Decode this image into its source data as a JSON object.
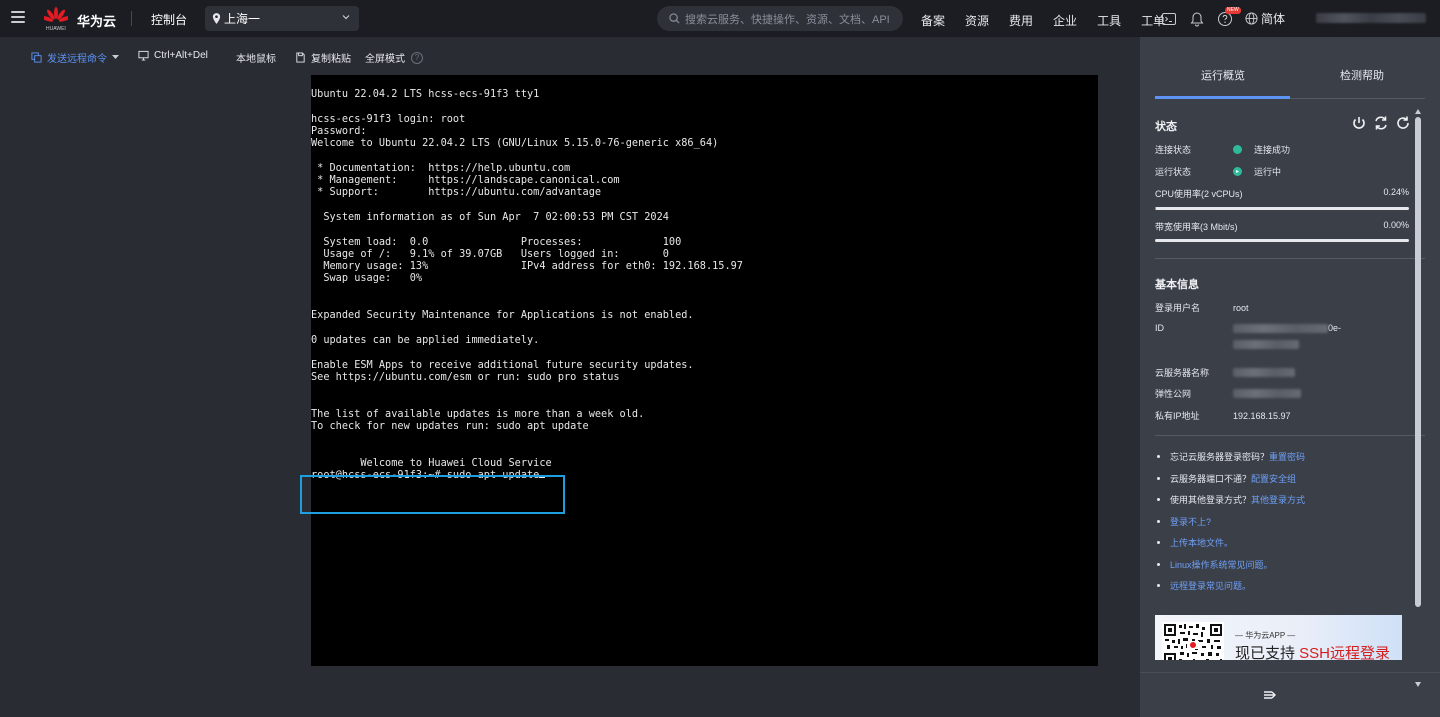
{
  "topbar": {
    "logo_text": "HUAWEI",
    "brand": "华为云",
    "console": "控制台",
    "region": "上海一",
    "search_placeholder": "搜索云服务、快捷操作、资源、文档、API",
    "nav": [
      "备案",
      "资源",
      "费用",
      "企业",
      "工具",
      "工单"
    ],
    "new_badge": "NEW",
    "language": "简体"
  },
  "toolbar": {
    "send_command": "发送远程命令",
    "ctrl_alt_del": "Ctrl+Alt+Del",
    "local_mouse": "本地鼠标",
    "copy_paste": "复制粘贴",
    "fullscreen": "全屏模式",
    "help": "?"
  },
  "terminal": {
    "lines": "Ubuntu 22.04.2 LTS hcss-ecs-91f3 tty1\n\nhcss-ecs-91f3 login: root\nPassword:\nWelcome to Ubuntu 22.04.2 LTS (GNU/Linux 5.15.0-76-generic x86_64)\n\n * Documentation:  https://help.ubuntu.com\n * Management:     https://landscape.canonical.com\n * Support:        https://ubuntu.com/advantage\n\n  System information as of Sun Apr  7 02:00:53 PM CST 2024\n\n  System load:  0.0               Processes:             100\n  Usage of /:   9.1% of 39.07GB   Users logged in:       0\n  Memory usage: 13%               IPv4 address for eth0: 192.168.15.97\n  Swap usage:   0%\n\n\nExpanded Security Maintenance for Applications is not enabled.\n\n0 updates can be applied immediately.\n\nEnable ESM Apps to receive additional future security updates.\nSee https://ubuntu.com/esm or run: sudo pro status\n\n\nThe list of available updates is more than a week old.\nTo check for new updates run: sudo apt update\n\n\n        Welcome to Huawei Cloud Service\n",
    "prompt": "root@hcss-ecs-91f3:~# sudo apt update"
  },
  "panel": {
    "tabs": [
      "运行概览",
      "检测帮助"
    ],
    "status_title": "状态",
    "connection_label": "连接状态",
    "connection_value": "连接成功",
    "run_label": "运行状态",
    "run_value": "运行中",
    "cpu_label": "CPU使用率(2 vCPUs)",
    "cpu_value": "0.24%",
    "cpu_fraction": 0.0024,
    "bw_label": "带宽使用率(3 Mbit/s)",
    "bw_value": "0.00%",
    "bw_fraction": 0,
    "basic_title": "基本信息",
    "user_label": "登录用户名",
    "user_value": "root",
    "id_label": "ID",
    "id_visible": "0e-",
    "server_name_label": "云服务器名称",
    "eip_label": "弹性公网",
    "private_ip_label": "私有IP地址",
    "private_ip_value": "192.168.15.97",
    "help_links": [
      {
        "text": "忘记云服务器登录密码？",
        "link": "重置密码"
      },
      {
        "text": "云服务器端口不通？",
        "link": "配置安全组"
      },
      {
        "text": "使用其他登录方式？",
        "link": "其他登录方式"
      },
      {
        "text": "",
        "link": "登录不上?"
      },
      {
        "text": "",
        "link": "上传本地文件。"
      },
      {
        "text": "",
        "link": "Linux操作系统常见问题。"
      },
      {
        "text": "",
        "link": "远程登录常见问题。"
      }
    ],
    "banner_sub": "— 华为云APP —",
    "banner_main_prefix": "现已支持 ",
    "banner_main_red": "SSH远程登录"
  },
  "colors": {
    "accent_blue": "#5c93f5",
    "status_green": "#2dbb9b",
    "highlight_box": "#1ea0e0"
  }
}
